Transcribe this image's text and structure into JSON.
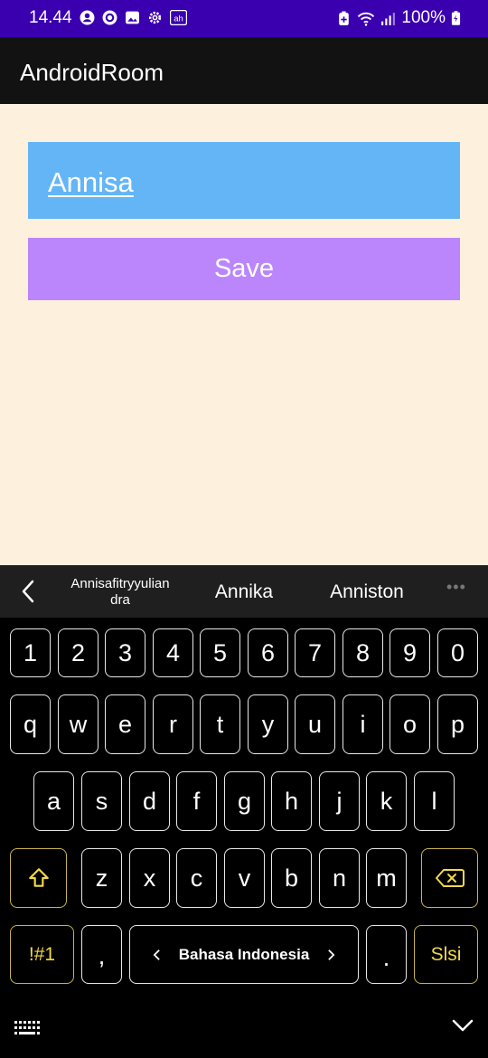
{
  "status_bar": {
    "time": "14.44",
    "battery": "100%",
    "left_icons": [
      "account-circle-icon",
      "sync-icon",
      "gallery-icon",
      "settings-icon",
      "app-notification-icon"
    ],
    "right_icons": [
      "battery-saver-icon",
      "wifi-icon",
      "signal-icon",
      "battery-charging-icon"
    ]
  },
  "app_bar": {
    "title": "AndroidRoom"
  },
  "form": {
    "name_value": "Annisa",
    "save_label": "Save"
  },
  "colors": {
    "status_bar": "#3a00b0",
    "app_bar": "#121212",
    "background": "#fdf0dd",
    "input_bg": "#64b5f6",
    "button_bg": "#bb86fc"
  },
  "keyboard": {
    "suggestions": [
      "Annisafitryyulian dra",
      "Annika",
      "Anniston"
    ],
    "number_row": [
      "1",
      "2",
      "3",
      "4",
      "5",
      "6",
      "7",
      "8",
      "9",
      "0"
    ],
    "row1": [
      "q",
      "w",
      "e",
      "r",
      "t",
      "y",
      "u",
      "i",
      "o",
      "p"
    ],
    "row2": [
      "a",
      "s",
      "d",
      "f",
      "g",
      "h",
      "j",
      "k",
      "l"
    ],
    "row3": [
      "z",
      "x",
      "c",
      "v",
      "b",
      "n",
      "m"
    ],
    "symbols_label": "!#1",
    "comma": ",",
    "space_label": "Bahasa Indonesia",
    "period": ".",
    "action_label": "Slsi"
  }
}
